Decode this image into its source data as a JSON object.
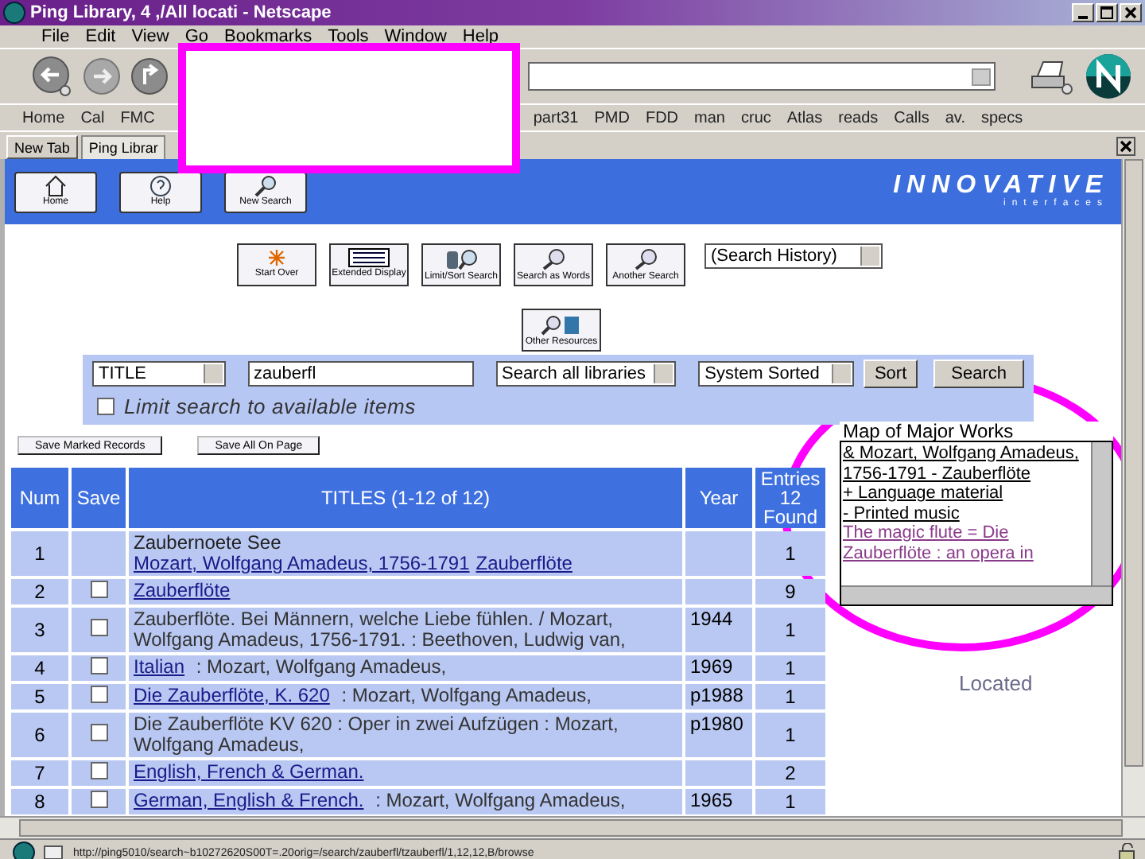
{
  "window": {
    "title": "Ping Library, 4 ,/All locati - Netscape"
  },
  "menu": [
    "File",
    "Edit",
    "View",
    "Go",
    "Bookmarks",
    "Tools",
    "Window",
    "Help"
  ],
  "bookmarks": {
    "left": [
      "Home",
      "Cal",
      "FMC"
    ],
    "right": [
      "part31",
      "PMD",
      "FDD",
      "man",
      "cruc",
      "Atlas",
      "reads",
      "Calls",
      "av.",
      "specs"
    ]
  },
  "new_tab_button": "New Tab",
  "tabs": [
    {
      "label": "Ping Librar",
      "selected": true
    }
  ],
  "header": {
    "buttons": [
      {
        "label": "Home",
        "kind": "home"
      },
      {
        "label": "Help",
        "kind": "help"
      },
      {
        "label": "New Search",
        "kind": "search"
      }
    ],
    "logo": "INNOVATIVE",
    "logo_sub": "interfaces"
  },
  "tools": [
    {
      "label": "Start Over",
      "kind": "star"
    },
    {
      "label": "Extended Display",
      "kind": "list"
    },
    {
      "label": "Limit/Sort Search",
      "kind": "hand"
    },
    {
      "label": "Search as Words",
      "kind": "search"
    },
    {
      "label": "Another Search",
      "kind": "search"
    }
  ],
  "history_select": "(Search History)",
  "other_resources": "Other Resources",
  "search": {
    "index": "TITLE",
    "query": "zauberfl",
    "scope": "Search all libraries",
    "sort": "System Sorted",
    "sort_button": "Sort",
    "search_button": "Search",
    "limit_label": "Limit search to available items",
    "limit_checked": false
  },
  "save_buttons": [
    "Save Marked Records",
    "Save All On Page"
  ],
  "table": {
    "columns": [
      "Num",
      "Save",
      "TITLES (1-12 of 12)",
      "Year",
      "Entries 12 Found"
    ],
    "rows": [
      {
        "num": "1",
        "kind": "reference",
        "title": [
          {
            "text": "Zaubernoete",
            "link": false
          },
          {
            "text": "  See ",
            "link": false
          },
          {
            "text": "Mozart, Wolfgang Amadeus, 1756-1791",
            "link": true
          },
          {
            "text": "Zauberflöte",
            "link": true
          }
        ],
        "year": "",
        "entries": "1"
      },
      {
        "num": "2",
        "kind": "record",
        "checked": false,
        "title": [
          {
            "text": "Zauberflöte",
            "link": true
          }
        ],
        "year": "",
        "entries": "9"
      },
      {
        "num": "3",
        "kind": "record",
        "checked": false,
        "title": [
          {
            "text": "Zauberflöte. Bei Männern, welche Liebe fühlen. / Mozart, Wolfgang Amadeus, 1756-1791. : Beethoven, Ludwig van,",
            "link": false
          }
        ],
        "year": "1944",
        "entries": "1"
      },
      {
        "num": "4",
        "kind": "record",
        "checked": false,
        "title": [
          {
            "text": "Italian",
            "link": true
          },
          {
            "text": " : Mozart, Wolfgang Amadeus,",
            "link": false
          }
        ],
        "year": "1969",
        "entries": "1"
      },
      {
        "num": "5",
        "kind": "record",
        "checked": false,
        "title": [
          {
            "text": "Die Zauberflöte, K. 620",
            "link": true
          },
          {
            "text": " : Mozart, Wolfgang Amadeus,",
            "link": false
          }
        ],
        "year": "p1988",
        "entries": "1"
      },
      {
        "num": "6",
        "kind": "record",
        "checked": false,
        "title": [
          {
            "text": "Die Zauberflöte KV 620 : Oper in zwei Aufzügen : Mozart, Wolfgang Amadeus,",
            "link": false
          }
        ],
        "year": "p1980",
        "entries": "1"
      },
      {
        "num": "7",
        "kind": "record",
        "checked": false,
        "title": [
          {
            "text": "English, French & German.",
            "link": true
          }
        ],
        "year": "",
        "entries": "2"
      },
      {
        "num": "8",
        "kind": "record",
        "checked": false,
        "title": [
          {
            "text": "German, English & French.",
            "link": true
          },
          {
            "text": " : Mozart, Wolfgang Amadeus,",
            "link": false
          }
        ],
        "year": "1965",
        "entries": "1"
      }
    ]
  },
  "map_popup": {
    "label": "Map of Major Works",
    "items": [
      {
        "text": "& Mozart, Wolfgang Amadeus, 1756-1791 - Zauberflöte",
        "visited": false
      },
      {
        "text": "+ Language material",
        "visited": false
      },
      {
        "text": "- Printed music",
        "visited": false
      },
      {
        "text": "The magic flute = Die Zauberflöte : an opera in",
        "visited": true
      }
    ]
  },
  "located_label": "Located",
  "status_bar": {
    "url": "http://ping5010/search~b10272620S00T=.20orig=/search/zauberfl/tzauberfl/1,12,12,B/browse"
  },
  "annotations": [
    {
      "kind": "rectangle"
    },
    {
      "kind": "ellipse"
    }
  ]
}
